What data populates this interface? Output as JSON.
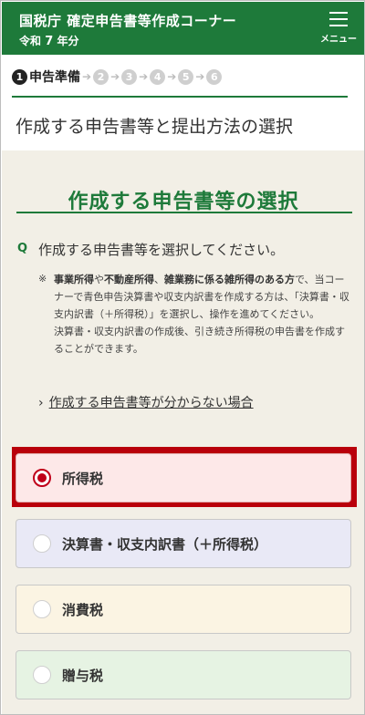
{
  "header": {
    "title": "国税庁 確定申告書等作成コーナー",
    "era": "令和",
    "year_num": "7",
    "year_suffix": "年分",
    "menu_label": "メニュー"
  },
  "steps": {
    "current_num": "1",
    "current_label": "申告準備",
    "others": [
      "2",
      "3",
      "4",
      "5",
      "6"
    ]
  },
  "page_title": "作成する申告書等と提出方法の選択",
  "section_title": "作成する申告書等の選択",
  "question": {
    "mark": "Q",
    "text": "作成する申告書等を選択してください。"
  },
  "note": {
    "mark": "※",
    "bold_1": "事業所得",
    "t1": "や",
    "bold_2": "不動産所得",
    "t2": "、",
    "bold_3": "雑業務に係る雑所得のある方",
    "t3": "で、当コーナーで青色申告決算書や収支内訳書を作成する方は、「決算書・収支内訳書（＋所得税）」を選択し、操作を進めてください。",
    "line2": "決算書・収支内訳書の作成後、引き続き所得税の申告書を作成することができます。"
  },
  "help_link": "作成する申告書等が分からない場合",
  "options": [
    {
      "label": "所得税",
      "selected": true
    },
    {
      "label": "決算書・収支内訳書（＋所得税）",
      "selected": false
    },
    {
      "label": "消費税",
      "selected": false
    },
    {
      "label": "贈与税",
      "selected": false
    }
  ],
  "colors": {
    "brand_green": "#1e7a3a",
    "highlight_red": "#b9000b",
    "radio_red": "#c0001a",
    "content_bg": "#f2efe6"
  }
}
